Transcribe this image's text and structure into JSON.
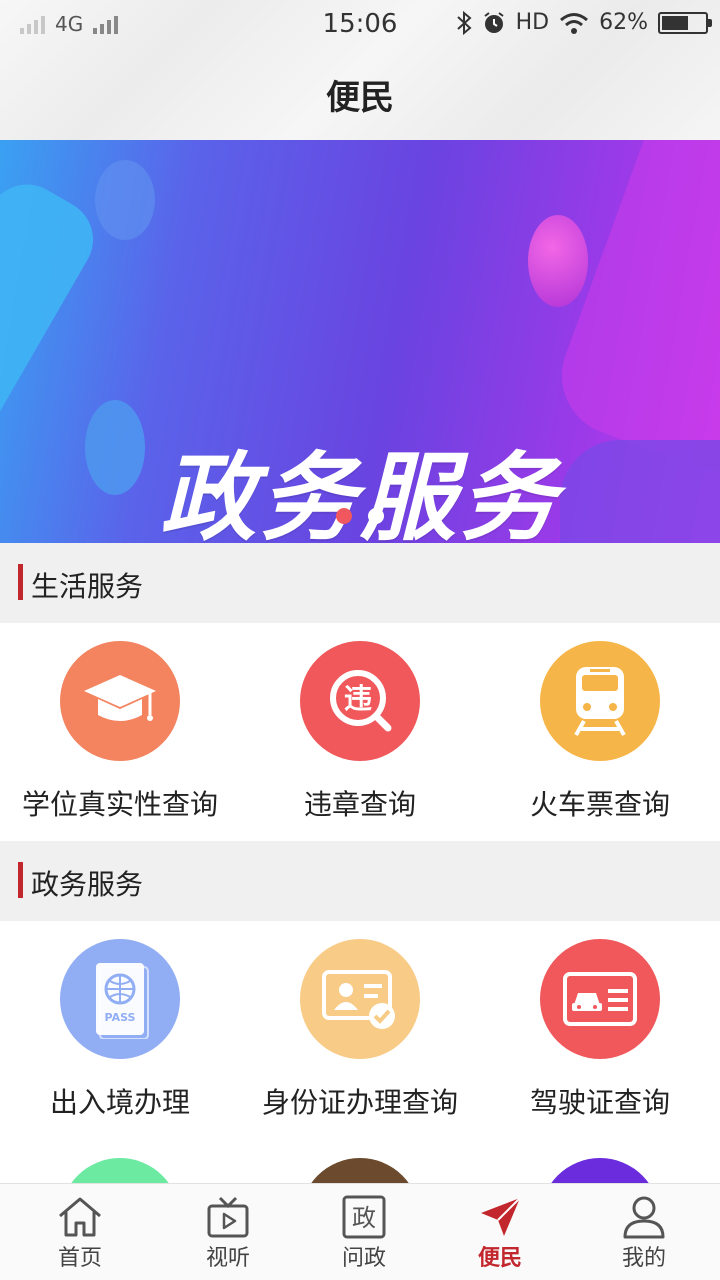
{
  "status_bar": {
    "network": "4G",
    "time": "15:06",
    "hd": "HD",
    "battery": "62%"
  },
  "page_title": "便民",
  "banner": {
    "title": "政务服务",
    "active_slide": 1,
    "slide_count": 2
  },
  "sections": [
    {
      "title": "生活服务",
      "items": [
        {
          "label": "学位真实性查询",
          "icon": "graduation-cap-icon",
          "color": "#f3845f"
        },
        {
          "label": "违章查询",
          "icon": "violation-search-icon",
          "color": "#f0585b"
        },
        {
          "label": "火车票查询",
          "icon": "train-icon",
          "color": "#f6b548"
        }
      ]
    },
    {
      "title": "政务服务",
      "items": [
        {
          "label": "出入境办理",
          "icon": "passport-icon",
          "color": "#91aef5"
        },
        {
          "label": "身份证办理查询",
          "icon": "id-card-icon",
          "color": "#f8cb87"
        },
        {
          "label": "驾驶证查询",
          "icon": "driver-license-icon",
          "color": "#f0585b"
        }
      ]
    }
  ],
  "partial_row_colors": [
    "#6ceaa2",
    "#6b4a2e",
    "#6a2cdc"
  ],
  "nav": [
    {
      "label": "首页",
      "icon": "home-icon"
    },
    {
      "label": "视听",
      "icon": "tv-icon"
    },
    {
      "label": "问政",
      "icon": "zheng-icon",
      "glyph": "政"
    },
    {
      "label": "便民",
      "icon": "paper-plane-icon",
      "active": true
    },
    {
      "label": "我的",
      "icon": "user-icon"
    }
  ],
  "colors": {
    "accent": "#c2272d",
    "section_bg": "#f0f0f0"
  }
}
